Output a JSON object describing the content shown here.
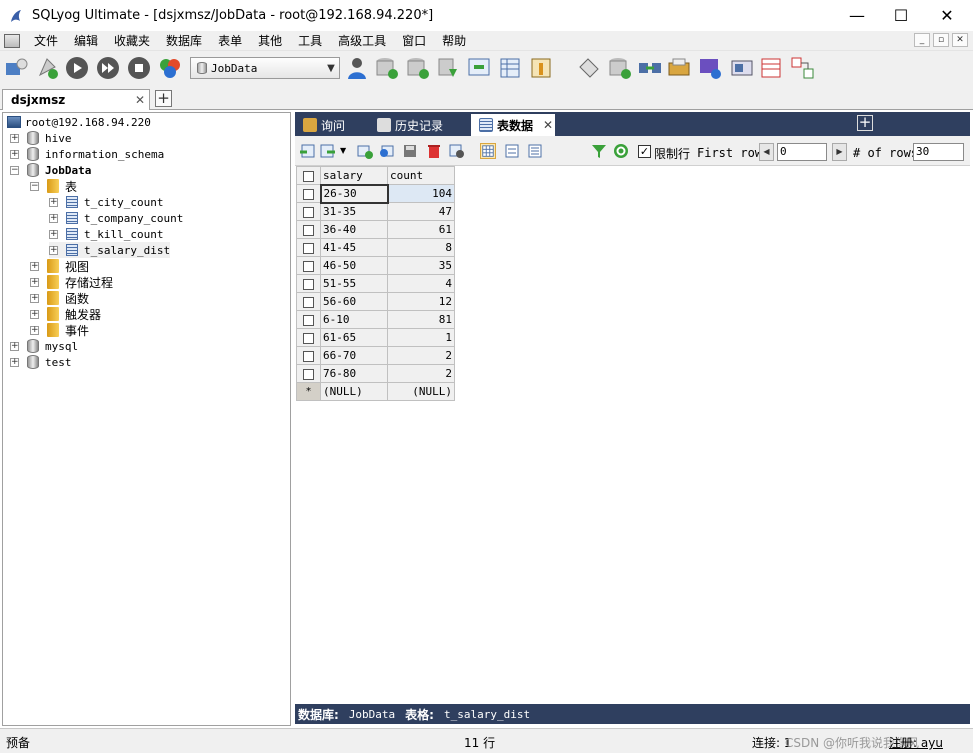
{
  "window": {
    "title": "SQLyog Ultimate - [dsjxmsz/JobData - root@192.168.94.220*]",
    "minimize": "—",
    "maximize": "☐",
    "close": "✕"
  },
  "menu": [
    "文件",
    "编辑",
    "收藏夹",
    "数据库",
    "表单",
    "其他",
    "工具",
    "高级工具",
    "窗口",
    "帮助"
  ],
  "mdi_controls": [
    "_",
    "▫",
    "✕"
  ],
  "toolbar": {
    "database_select": "JobData"
  },
  "connection_tab": {
    "label": "dsjxmsz",
    "close": "✕",
    "add": "+"
  },
  "object_browser": {
    "server": "root@192.168.94.220",
    "databases": [
      {
        "name": "hive",
        "expander": "+"
      },
      {
        "name": "information_schema",
        "expander": "+"
      },
      {
        "name": "JobData",
        "expander": "−"
      },
      {
        "name": "mysql",
        "expander": "+"
      },
      {
        "name": "test",
        "expander": "+"
      }
    ],
    "jobdata_children": {
      "tables_folder": "表",
      "tables": [
        "t_city_count",
        "t_company_count",
        "t_kill_count",
        "t_salary_dist"
      ],
      "folders": [
        "视图",
        "存储过程",
        "函数",
        "触发器",
        "事件"
      ]
    }
  },
  "query_tabs": {
    "tabs": [
      "询问",
      "历史记录",
      "表数据"
    ],
    "active": "表数据",
    "close": "✕",
    "add": "+"
  },
  "grid_toolbar": {
    "limit_rows_label": "限制行",
    "limit_rows_checked": "✓",
    "first_row_label": "First row",
    "first_row_value": "0",
    "num_rows_label": "# of rows",
    "num_rows_value": "30",
    "prev": "◀",
    "next": "▶"
  },
  "grid": {
    "columns": [
      "salary",
      "count"
    ],
    "rows": [
      [
        "26-30",
        "104"
      ],
      [
        "31-35",
        "47"
      ],
      [
        "36-40",
        "61"
      ],
      [
        "41-45",
        "8"
      ],
      [
        "46-50",
        "35"
      ],
      [
        "51-55",
        "4"
      ],
      [
        "56-60",
        "12"
      ],
      [
        "6-10",
        "81"
      ],
      [
        "61-65",
        "1"
      ],
      [
        "66-70",
        "2"
      ],
      [
        "76-80",
        "2"
      ]
    ],
    "new_row_marker": "*",
    "null_text": "(NULL)"
  },
  "info_bar": {
    "db_label": "数据库:",
    "db_value": "JobData",
    "table_label": "表格:",
    "table_value": "t_salary_dist"
  },
  "status_bar": {
    "left": "预备",
    "rows": "11 行",
    "connection": "连接: 1",
    "overlay": "CSDN @你听我说我像风",
    "register": "注册: ayu"
  },
  "colors": {
    "panel_header": "#2f3f5f",
    "chrome": "#f0f0f0",
    "grid_header": "#d4d0c8"
  }
}
